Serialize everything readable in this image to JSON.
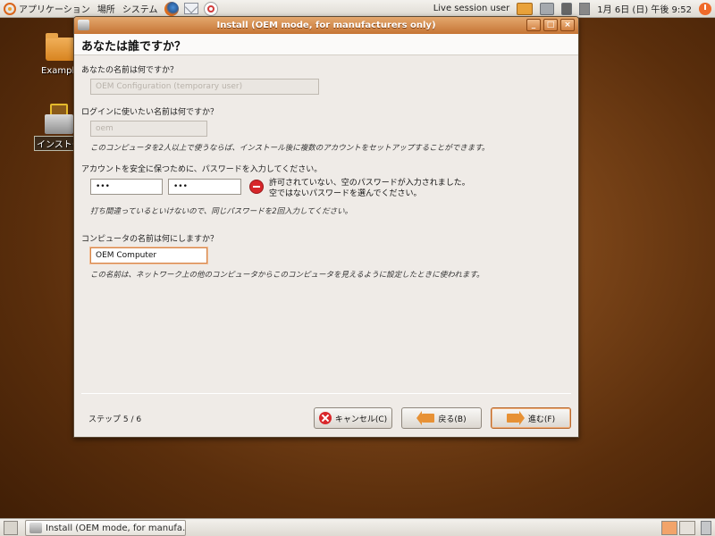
{
  "top_panel": {
    "menus": [
      "アプリケーション",
      "場所",
      "システム"
    ],
    "user": "Live session user",
    "clock": "1月 6日 (日) 午後 9:52"
  },
  "desktop": {
    "icons": [
      {
        "label": "Example",
        "icon": "folder-icon"
      },
      {
        "label": "インストー",
        "icon": "installer-icon"
      }
    ]
  },
  "window": {
    "title": "Install (OEM mode, for manufacturers only)",
    "controls": {
      "minimize": "_",
      "maximize": "□",
      "close": "×"
    },
    "heading": "あなたは誰ですか？",
    "name_label": "あなたの名前は何ですか？",
    "name_value": "OEM Configuration (temporary user)",
    "login_label": "ログインに使いたい名前は何ですか？",
    "login_value": "oem",
    "login_note": "このコンピュータを2人以上で使うならば、インストール後に複数のアカウントをセットアップすることができます。",
    "password_label": "アカウントを安全に保つために、パスワードを入力してください。",
    "password_value": "•••",
    "password_confirm_value": "•••",
    "password_error_line1": "許可されていない、空のパスワードが入力されました。",
    "password_error_line2": "空ではないパスワードを選んでください。",
    "password_note": "打ち間違っているといけないので、同じパスワードを2回入力してください。",
    "hostname_label": "コンピュータの名前は何にしますか？",
    "hostname_value": "OEM Computer",
    "hostname_note": "この名前は、ネットワーク上の他のコンピュータからこのコンピュータを見えるように設定したときに使われます。",
    "step_text": "ステップ 5 / 6",
    "buttons": {
      "cancel": "キャンセル(C)",
      "back": "戻る(B)",
      "forward": "進む(F)"
    }
  },
  "bottom_panel": {
    "task": "Install (OEM mode, for manufa…"
  },
  "colors": {
    "accent": "#c57434",
    "error": "#d7262a",
    "desktop": "#7a4418"
  }
}
